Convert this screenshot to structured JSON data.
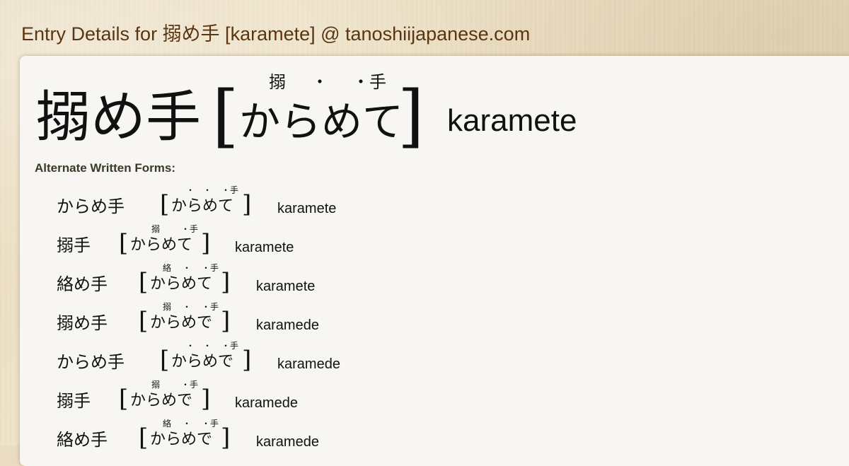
{
  "site_title": "Entry Details for 搦め手 [karamete] @ tanoshiijapanese.com",
  "entry": {
    "written": "搦め手",
    "reading": "からめて",
    "furigana": [
      "搦",
      "・",
      "・手"
    ],
    "romaji": "karamete",
    "bracket_open": "[",
    "bracket_close": "]"
  },
  "alternate_heading": "Alternate Written Forms:",
  "alternates": [
    {
      "written": "からめ手",
      "reading": "からめて",
      "furigana": [
        "・",
        "・",
        "・手"
      ],
      "romaji": "karamete"
    },
    {
      "written": "搦手",
      "reading": "からめて",
      "furigana": [
        "搦",
        "・手"
      ],
      "romaji": "karamete"
    },
    {
      "written": "絡め手",
      "reading": "からめて",
      "furigana": [
        "絡",
        "・",
        "・手"
      ],
      "romaji": "karamete"
    },
    {
      "written": "搦め手",
      "reading": "からめで",
      "furigana": [
        "搦",
        "・",
        "・手"
      ],
      "romaji": "karamede"
    },
    {
      "written": "からめ手",
      "reading": "からめで",
      "furigana": [
        "・",
        "・",
        "・手"
      ],
      "romaji": "karamede"
    },
    {
      "written": "搦手",
      "reading": "からめで",
      "furigana": [
        "搦",
        "・手"
      ],
      "romaji": "karamede"
    },
    {
      "written": "絡め手",
      "reading": "からめで",
      "furigana": [
        "絡",
        "・",
        "・手"
      ],
      "romaji": "karamede"
    }
  ]
}
